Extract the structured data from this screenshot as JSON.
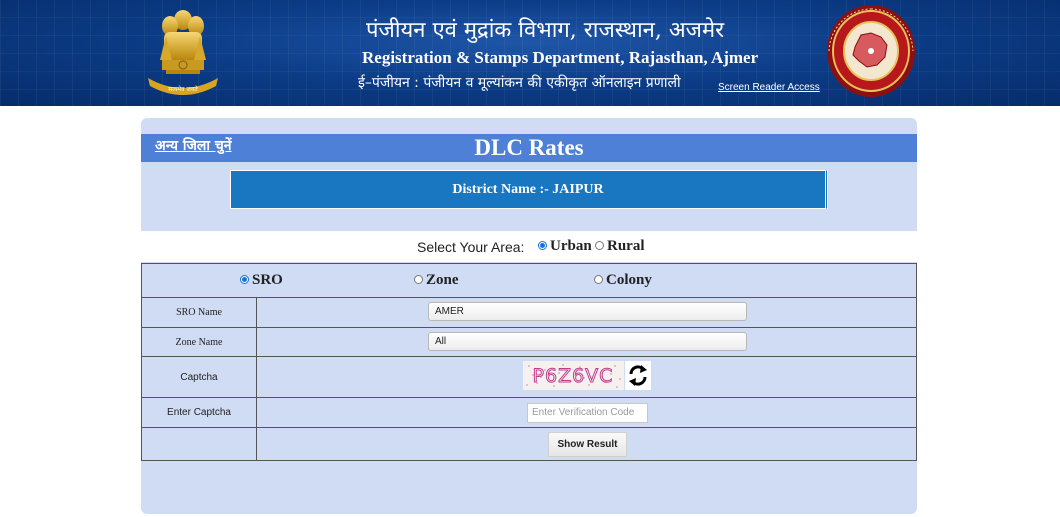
{
  "header": {
    "title_hindi": "पंजीयन एवं मुद्रांक विभाग, राजस्थान, अजमेर",
    "title_english": "Registration & Stamps Department, Rajasthan, Ajmer",
    "subtitle_hindi": "ई–पंजीयन : पंजीयन व मूल्यांकन की एकीकृत ऑनलाइन प्रणाली",
    "screen_reader_link": "Screen Reader Access",
    "emblem_icon": "national-emblem-icon",
    "seal_icon": "rajasthan-seal-icon",
    "emblem_motto": "सत्यमेव जयते"
  },
  "title_bar": {
    "other_district_link": "अन्य जिला चुनें",
    "page_title": "DLC Rates"
  },
  "district": {
    "label": "District Name :- JAIPUR"
  },
  "area": {
    "label": "Select Your Area:",
    "options": [
      {
        "label": "Urban",
        "selected": true
      },
      {
        "label": "Rural",
        "selected": false
      }
    ]
  },
  "search_by": {
    "options": [
      {
        "label": "SRO",
        "selected": true
      },
      {
        "label": "Zone",
        "selected": false
      },
      {
        "label": "Colony",
        "selected": false
      }
    ]
  },
  "form": {
    "sro_label": "SRO Name",
    "sro_value": "AMER",
    "zone_label": "Zone Name",
    "zone_value": "All",
    "captcha_label": "Captcha",
    "captcha_text": "P6Z6VC",
    "refresh_icon": "refresh-icon",
    "enter_captcha_label": "Enter Captcha",
    "enter_captcha_placeholder": "Enter Verification Code",
    "submit_label": "Show Result"
  },
  "colors": {
    "header_bg": "#0c3d88",
    "title_bar_bg": "#4d80d6",
    "district_bg": "#1976c1",
    "panel_bg": "#cfdcf3",
    "radio_accent": "#1a6fd6"
  }
}
